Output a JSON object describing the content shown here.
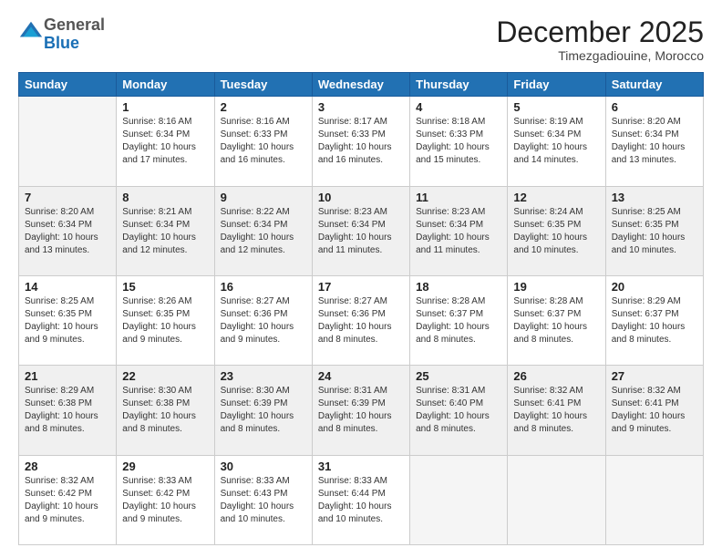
{
  "logo": {
    "general": "General",
    "blue": "Blue"
  },
  "header": {
    "month": "December 2025",
    "location": "Timezgadiouine, Morocco"
  },
  "days_of_week": [
    "Sunday",
    "Monday",
    "Tuesday",
    "Wednesday",
    "Thursday",
    "Friday",
    "Saturday"
  ],
  "weeks": [
    [
      {
        "day": "",
        "info": ""
      },
      {
        "day": "1",
        "info": "Sunrise: 8:16 AM\nSunset: 6:34 PM\nDaylight: 10 hours\nand 17 minutes."
      },
      {
        "day": "2",
        "info": "Sunrise: 8:16 AM\nSunset: 6:33 PM\nDaylight: 10 hours\nand 16 minutes."
      },
      {
        "day": "3",
        "info": "Sunrise: 8:17 AM\nSunset: 6:33 PM\nDaylight: 10 hours\nand 16 minutes."
      },
      {
        "day": "4",
        "info": "Sunrise: 8:18 AM\nSunset: 6:33 PM\nDaylight: 10 hours\nand 15 minutes."
      },
      {
        "day": "5",
        "info": "Sunrise: 8:19 AM\nSunset: 6:34 PM\nDaylight: 10 hours\nand 14 minutes."
      },
      {
        "day": "6",
        "info": "Sunrise: 8:20 AM\nSunset: 6:34 PM\nDaylight: 10 hours\nand 13 minutes."
      }
    ],
    [
      {
        "day": "7",
        "info": "Sunrise: 8:20 AM\nSunset: 6:34 PM\nDaylight: 10 hours\nand 13 minutes."
      },
      {
        "day": "8",
        "info": "Sunrise: 8:21 AM\nSunset: 6:34 PM\nDaylight: 10 hours\nand 12 minutes."
      },
      {
        "day": "9",
        "info": "Sunrise: 8:22 AM\nSunset: 6:34 PM\nDaylight: 10 hours\nand 12 minutes."
      },
      {
        "day": "10",
        "info": "Sunrise: 8:23 AM\nSunset: 6:34 PM\nDaylight: 10 hours\nand 11 minutes."
      },
      {
        "day": "11",
        "info": "Sunrise: 8:23 AM\nSunset: 6:34 PM\nDaylight: 10 hours\nand 11 minutes."
      },
      {
        "day": "12",
        "info": "Sunrise: 8:24 AM\nSunset: 6:35 PM\nDaylight: 10 hours\nand 10 minutes."
      },
      {
        "day": "13",
        "info": "Sunrise: 8:25 AM\nSunset: 6:35 PM\nDaylight: 10 hours\nand 10 minutes."
      }
    ],
    [
      {
        "day": "14",
        "info": "Sunrise: 8:25 AM\nSunset: 6:35 PM\nDaylight: 10 hours\nand 9 minutes."
      },
      {
        "day": "15",
        "info": "Sunrise: 8:26 AM\nSunset: 6:35 PM\nDaylight: 10 hours\nand 9 minutes."
      },
      {
        "day": "16",
        "info": "Sunrise: 8:27 AM\nSunset: 6:36 PM\nDaylight: 10 hours\nand 9 minutes."
      },
      {
        "day": "17",
        "info": "Sunrise: 8:27 AM\nSunset: 6:36 PM\nDaylight: 10 hours\nand 8 minutes."
      },
      {
        "day": "18",
        "info": "Sunrise: 8:28 AM\nSunset: 6:37 PM\nDaylight: 10 hours\nand 8 minutes."
      },
      {
        "day": "19",
        "info": "Sunrise: 8:28 AM\nSunset: 6:37 PM\nDaylight: 10 hours\nand 8 minutes."
      },
      {
        "day": "20",
        "info": "Sunrise: 8:29 AM\nSunset: 6:37 PM\nDaylight: 10 hours\nand 8 minutes."
      }
    ],
    [
      {
        "day": "21",
        "info": "Sunrise: 8:29 AM\nSunset: 6:38 PM\nDaylight: 10 hours\nand 8 minutes."
      },
      {
        "day": "22",
        "info": "Sunrise: 8:30 AM\nSunset: 6:38 PM\nDaylight: 10 hours\nand 8 minutes."
      },
      {
        "day": "23",
        "info": "Sunrise: 8:30 AM\nSunset: 6:39 PM\nDaylight: 10 hours\nand 8 minutes."
      },
      {
        "day": "24",
        "info": "Sunrise: 8:31 AM\nSunset: 6:39 PM\nDaylight: 10 hours\nand 8 minutes."
      },
      {
        "day": "25",
        "info": "Sunrise: 8:31 AM\nSunset: 6:40 PM\nDaylight: 10 hours\nand 8 minutes."
      },
      {
        "day": "26",
        "info": "Sunrise: 8:32 AM\nSunset: 6:41 PM\nDaylight: 10 hours\nand 8 minutes."
      },
      {
        "day": "27",
        "info": "Sunrise: 8:32 AM\nSunset: 6:41 PM\nDaylight: 10 hours\nand 9 minutes."
      }
    ],
    [
      {
        "day": "28",
        "info": "Sunrise: 8:32 AM\nSunset: 6:42 PM\nDaylight: 10 hours\nand 9 minutes."
      },
      {
        "day": "29",
        "info": "Sunrise: 8:33 AM\nSunset: 6:42 PM\nDaylight: 10 hours\nand 9 minutes."
      },
      {
        "day": "30",
        "info": "Sunrise: 8:33 AM\nSunset: 6:43 PM\nDaylight: 10 hours\nand 10 minutes."
      },
      {
        "day": "31",
        "info": "Sunrise: 8:33 AM\nSunset: 6:44 PM\nDaylight: 10 hours\nand 10 minutes."
      },
      {
        "day": "",
        "info": ""
      },
      {
        "day": "",
        "info": ""
      },
      {
        "day": "",
        "info": ""
      }
    ]
  ]
}
